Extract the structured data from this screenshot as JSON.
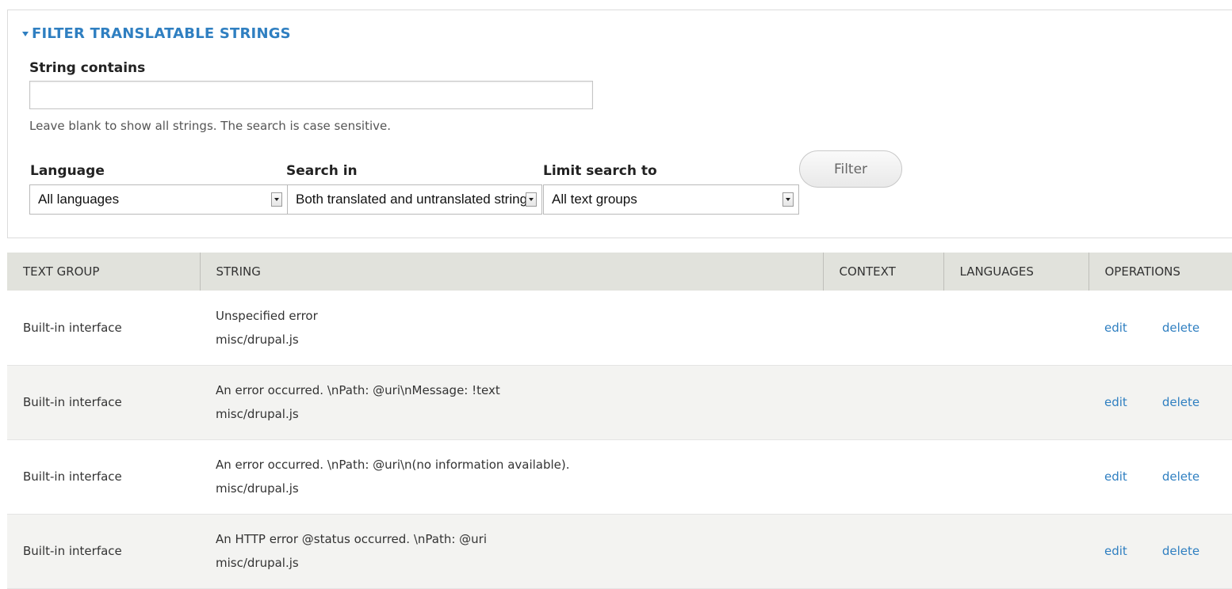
{
  "filter": {
    "legend": "FILTER TRANSLATABLE STRINGS",
    "string_contains_label": "String contains",
    "string_contains_value": "",
    "help_text": "Leave blank to show all strings. The search is case sensitive.",
    "language_label": "Language",
    "language_value": "All languages",
    "search_in_label": "Search in",
    "search_in_value": "Both translated and untranslated strings",
    "limit_label": "Limit search to",
    "limit_value": "All text groups",
    "filter_button": "Filter"
  },
  "table": {
    "headers": [
      "TEXT GROUP",
      "STRING",
      "CONTEXT",
      "LANGUAGES",
      "OPERATIONS"
    ],
    "rows": [
      {
        "group": "Built-in interface",
        "string": "Unspecified error",
        "location": "misc/drupal.js",
        "context": "",
        "languages": "",
        "edit": "edit",
        "delete": "delete"
      },
      {
        "group": "Built-in interface",
        "string": "An error occurred. \\nPath: @uri\\nMessage: !text",
        "location": "misc/drupal.js",
        "context": "",
        "languages": "",
        "edit": "edit",
        "delete": "delete"
      },
      {
        "group": "Built-in interface",
        "string": "An error occurred. \\nPath: @uri\\n(no information available).",
        "location": "misc/drupal.js",
        "context": "",
        "languages": "",
        "edit": "edit",
        "delete": "delete"
      },
      {
        "group": "Built-in interface",
        "string": "An HTTP error @status occurred. \\nPath: @uri",
        "location": "misc/drupal.js",
        "context": "",
        "languages": "",
        "edit": "edit",
        "delete": "delete"
      }
    ]
  },
  "colors": {
    "link": "#2f7fc1",
    "header_bg": "#e1e2dc",
    "row_alt_bg": "#f3f3f1"
  }
}
